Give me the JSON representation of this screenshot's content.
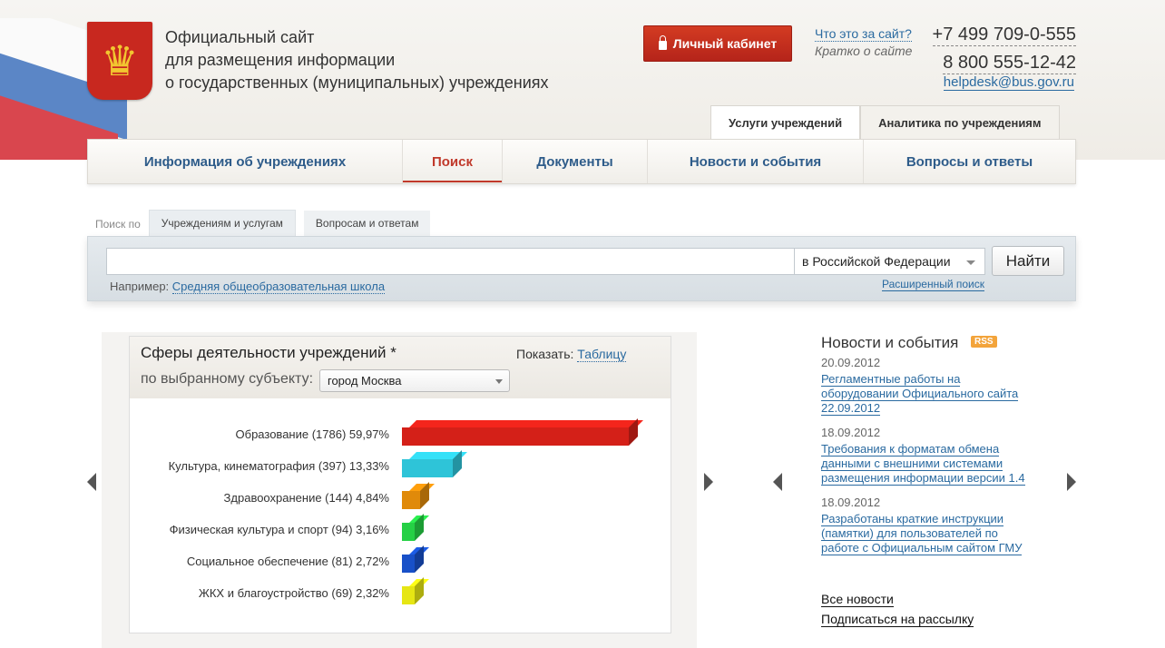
{
  "header": {
    "title_lines": [
      "Официальный сайт",
      "для размещения информации",
      "о государственных (муниципальных) учреждениях"
    ],
    "cabinet_label": "Личный кабинет",
    "about_link": "Что это за сайт?",
    "about_sub": "Кратко о сайте",
    "phones": [
      "+7 499 709-0-555",
      "8 800 555-12-42"
    ],
    "email": "helpdesk@bus.gov.ru"
  },
  "top_tabs": [
    "Услуги учреждений",
    "Аналитика по учреждениям"
  ],
  "nav": [
    "Информация об учреждениях",
    "Поиск",
    "Документы",
    "Новости и события",
    "Вопросы и ответы"
  ],
  "search": {
    "prefix": "Поиск по",
    "tabs": [
      "Учреждениям и услугам",
      "Вопросам и ответам"
    ],
    "input_value": "",
    "region": "в Российской Федерации",
    "button": "Найти",
    "example_label": "Например:",
    "example_link": "Средняя общеобразовательная школа",
    "advanced": "Расширенный поиск"
  },
  "chart_panel": {
    "title": "Сферы деятельности учреждений *",
    "show_label": "Показать:",
    "show_link": "Таблицу",
    "subject_label": "по выбранному субъекту:",
    "subject_value": "город Москва"
  },
  "chart_data": {
    "type": "bar",
    "orientation": "horizontal",
    "categories": [
      "Образование",
      "Культура, кинематография",
      "Здравоохранение",
      "Физическая культура и спорт",
      "Социальное обеспечение",
      "ЖКХ и благоустройство"
    ],
    "counts": [
      1786,
      397,
      144,
      94,
      81,
      69
    ],
    "values": [
      59.97,
      13.33,
      4.84,
      3.16,
      2.72,
      2.32
    ],
    "labels": [
      "Образование  (1786) 59,97%",
      "Культура, кинематография  (397) 13,33%",
      "Здравоохранение  (144) 4,84%",
      "Физическая культура и спорт  (94) 3,16%",
      "Социальное обеспечение  (81) 2,72%",
      "ЖКХ и благоустройство  (69) 2,32%"
    ],
    "colors": [
      "#d42018",
      "#2ec4d8",
      "#e08a0a",
      "#25d045",
      "#1850c8",
      "#e6e614"
    ]
  },
  "news": {
    "title": "Новости и события",
    "rss": "RSS",
    "items": [
      {
        "date": "20.09.2012",
        "text": "Регламентные работы на оборудовании Официального сайта 22.09.2012"
      },
      {
        "date": "18.09.2012",
        "text": "Требования к форматам обмена данными с внешними системами размещения информации версии 1.4"
      },
      {
        "date": "18.09.2012",
        "text": "Разработаны краткие инструкции (памятки) для пользователей по работе с Официальным сайтом ГМУ"
      }
    ],
    "all": "Все новости",
    "subscribe": "Подписаться на рассылку"
  }
}
